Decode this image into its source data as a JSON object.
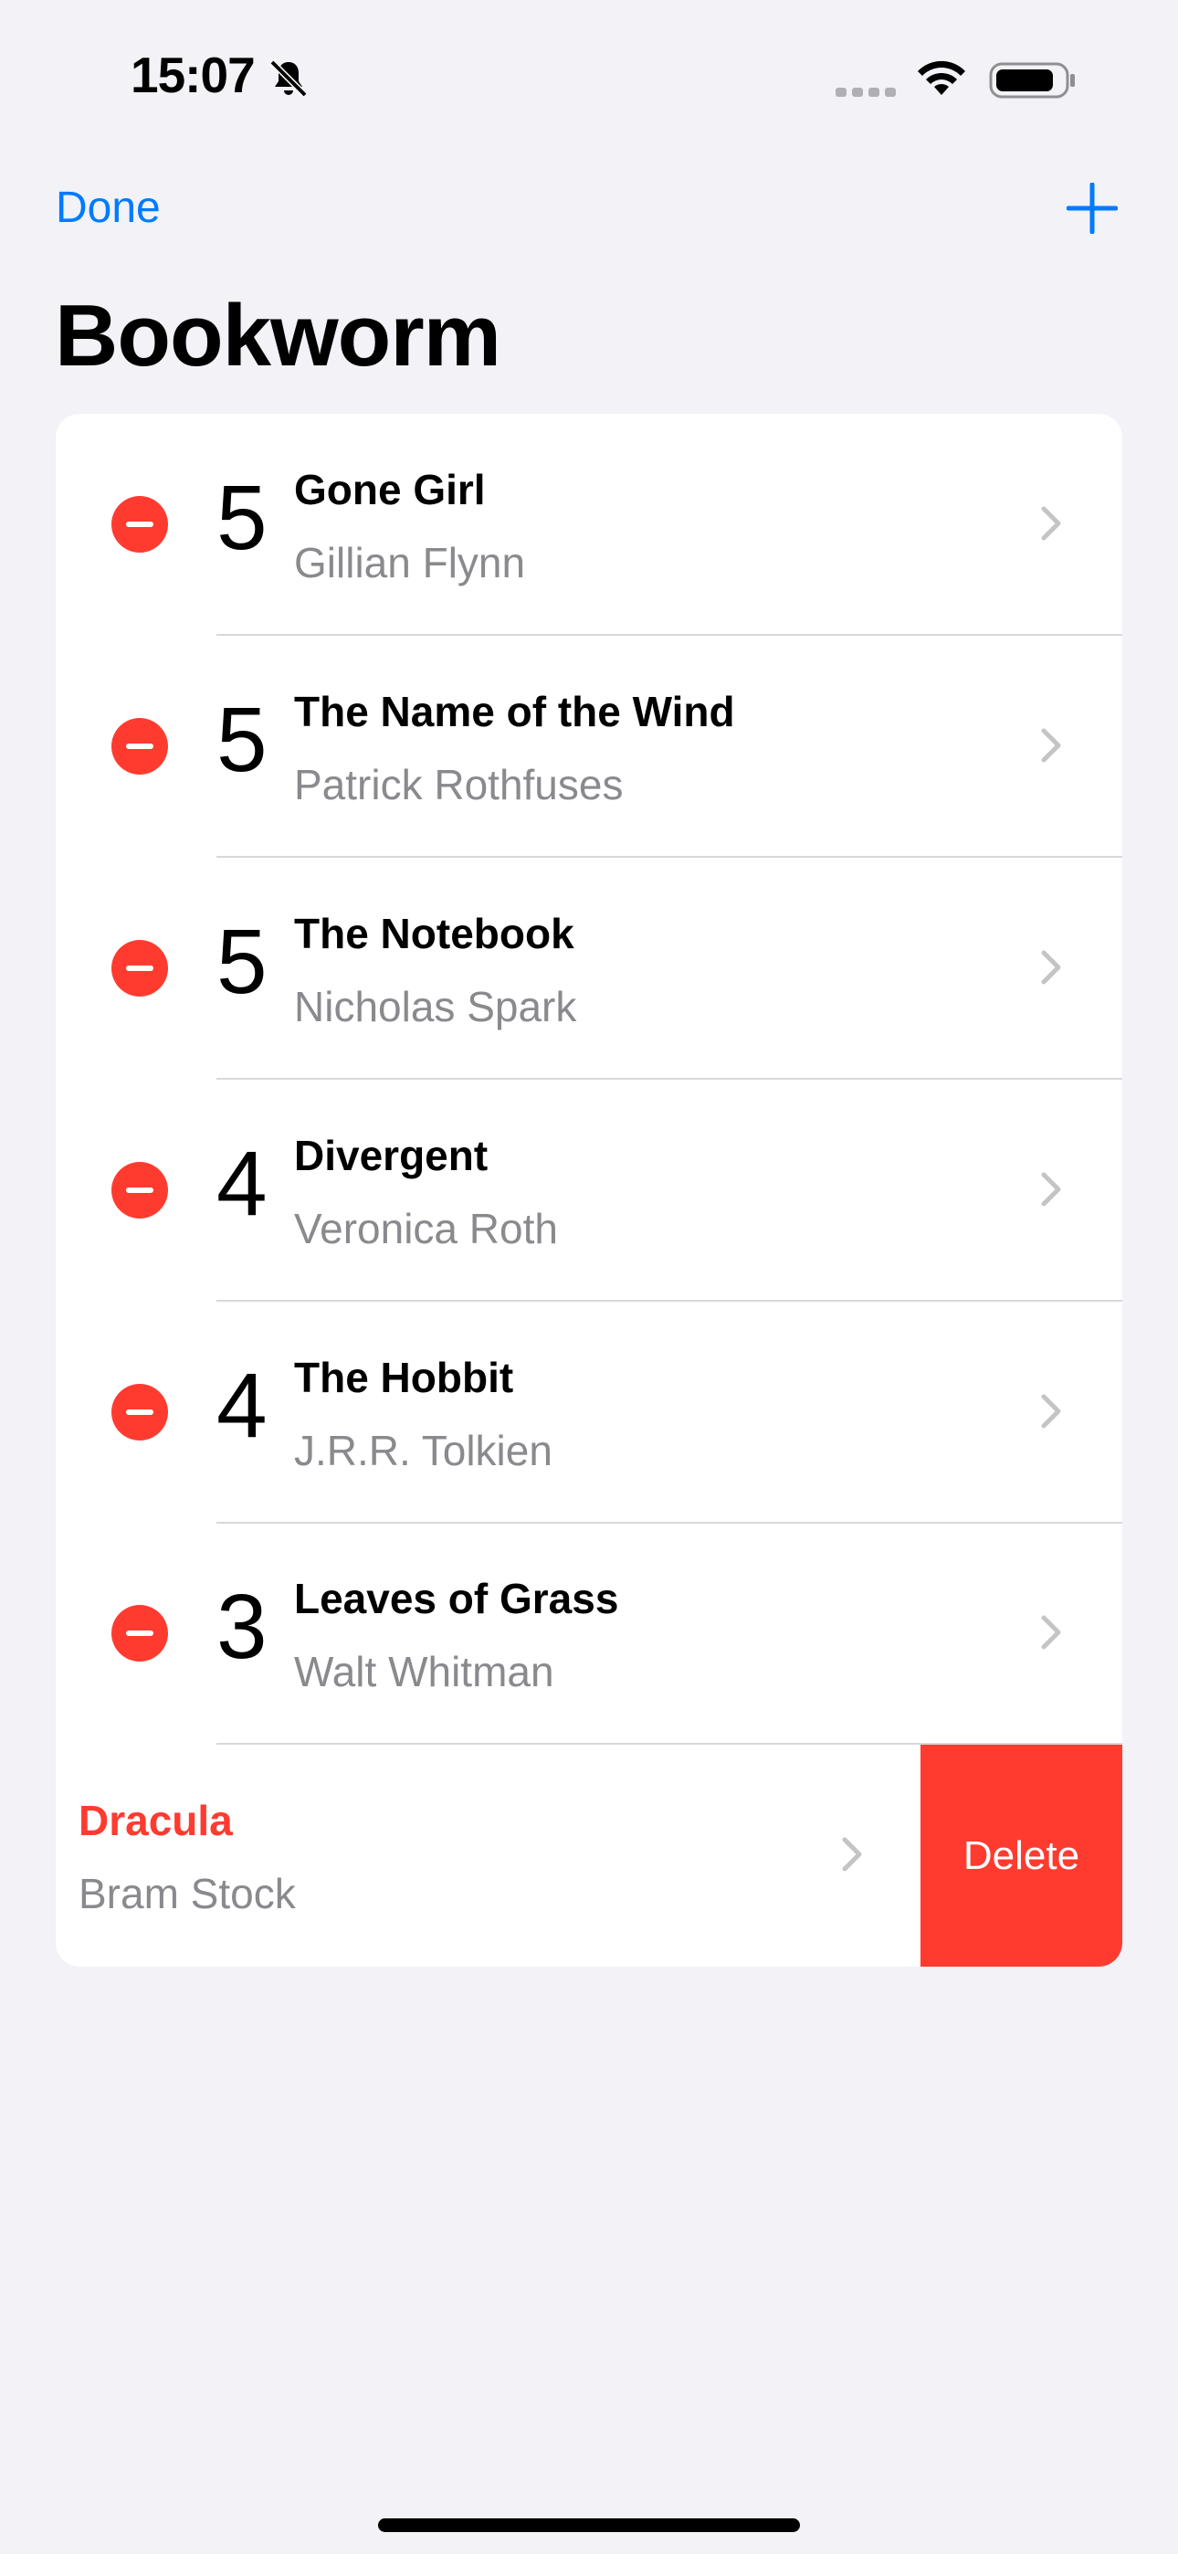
{
  "status_bar": {
    "time": "15:07"
  },
  "nav": {
    "done_label": "Done",
    "title": "Bookworm"
  },
  "books": [
    {
      "rating": "5",
      "title": "Gone Girl",
      "author": "Gillian Flynn"
    },
    {
      "rating": "5",
      "title": "The Name of the Wind",
      "author": "Patrick Rothfuses"
    },
    {
      "rating": "5",
      "title": "The Notebook",
      "author": "Nicholas Spark"
    },
    {
      "rating": "4",
      "title": "Divergent",
      "author": "Veronica Roth"
    },
    {
      "rating": "4",
      "title": "The Hobbit",
      "author": "J.R.R. Tolkien"
    },
    {
      "rating": "3",
      "title": "Leaves of Grass",
      "author": "Walt Whitman"
    }
  ],
  "swiped": {
    "title": "Dracula",
    "author": "Bram Stock",
    "delete_label": "Delete"
  },
  "colors": {
    "accent": "#007aff",
    "destructive": "#ff3b30",
    "background": "#f2f2f7",
    "secondary_text": "#8a8a8e"
  }
}
